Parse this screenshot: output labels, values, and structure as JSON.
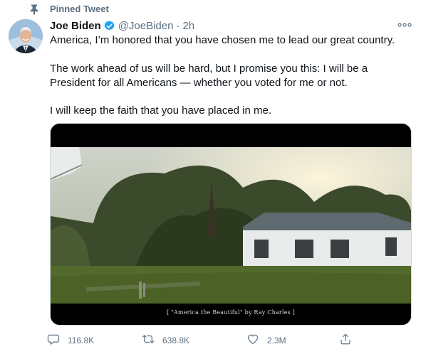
{
  "tweet": {
    "pinned_label": "Pinned Tweet",
    "author": {
      "display_name": "Joe Biden",
      "handle": "@JoeBiden",
      "separator": "·",
      "time": "2h",
      "verified": true
    },
    "lines": [
      "America, I’m honored that you have chosen me to lead our great country.",
      "The work ahead of us will be hard, but I promise you this: I will be a",
      "President for all Americans — whether you voted for me or not.",
      "I will keep the faith that you have placed in me."
    ],
    "media": {
      "caption": "[ \"America the Beautiful\" by Ray Charles ]"
    },
    "actions": {
      "replies": "116.8K",
      "retweets": "638.8K",
      "likes": "2.3M"
    },
    "icons": {
      "pin": "pin-icon",
      "verified": "verified-badge-icon",
      "more": "more-options-icon",
      "reply": "reply-icon",
      "retweet": "retweet-icon",
      "like": "heart-icon",
      "share": "share-icon"
    },
    "colors": {
      "verified_blue": "#1da1f2",
      "secondary_text": "#5b7083",
      "primary_text": "#0f1419"
    }
  }
}
